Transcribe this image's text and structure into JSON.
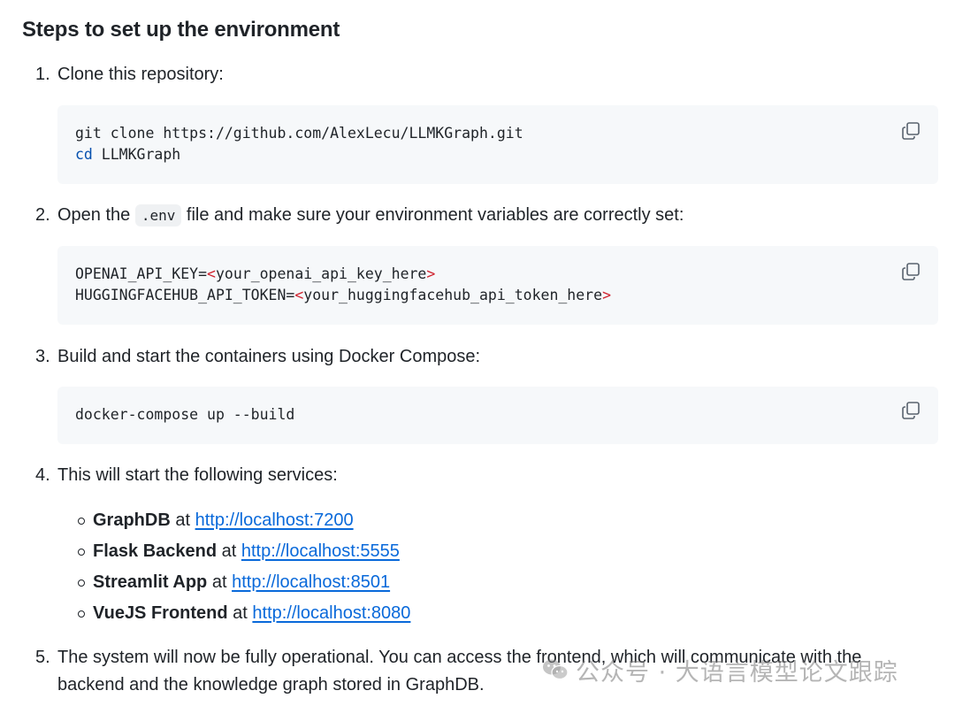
{
  "heading": "Steps to set up the environment",
  "steps": [
    {
      "num": "1.",
      "text": "Clone this repository:"
    },
    {
      "num": "2.",
      "pre": "Open the ",
      "code": ".env",
      "post": " file and make sure your environment variables are correctly set:"
    },
    {
      "num": "3.",
      "text": "Build and start the containers using Docker Compose:"
    },
    {
      "num": "4.",
      "text": "This will start the following services:"
    },
    {
      "num": "5.",
      "line1": "The system will now be fully operational. You can access the frontend, which will communicate with the",
      "line2": "backend and the knowledge graph stored in GraphDB."
    }
  ],
  "code_blocks": [
    {
      "line1": "git clone https://github.com/AlexLecu/LLMKGraph.git",
      "line2_kw": "cd",
      "line2_rest": " LLMKGraph"
    },
    {
      "key1": "OPENAI_API_KEY=",
      "val1": "your_openai_api_key_here",
      "key2": "HUGGINGFACEHUB_API_TOKEN=",
      "val2": "your_huggingfacehub_api_token_here",
      "lt": "<",
      "gt": ">"
    },
    {
      "line1": "docker-compose up --build"
    }
  ],
  "services": [
    {
      "name": "GraphDB",
      "at": " at ",
      "url": "http://localhost:7200"
    },
    {
      "name": "Flask Backend",
      "at": " at ",
      "url": "http://localhost:5555"
    },
    {
      "name": "Streamlit App",
      "at": " at ",
      "url": "http://localhost:8501"
    },
    {
      "name": "VueJS Frontend",
      "at": " at ",
      "url": "http://localhost:8080"
    }
  ],
  "watermark": "公众号 · 大语言模型论文跟踪",
  "icons": {
    "copy": "copy-icon",
    "wechat": "wechat-icon"
  }
}
